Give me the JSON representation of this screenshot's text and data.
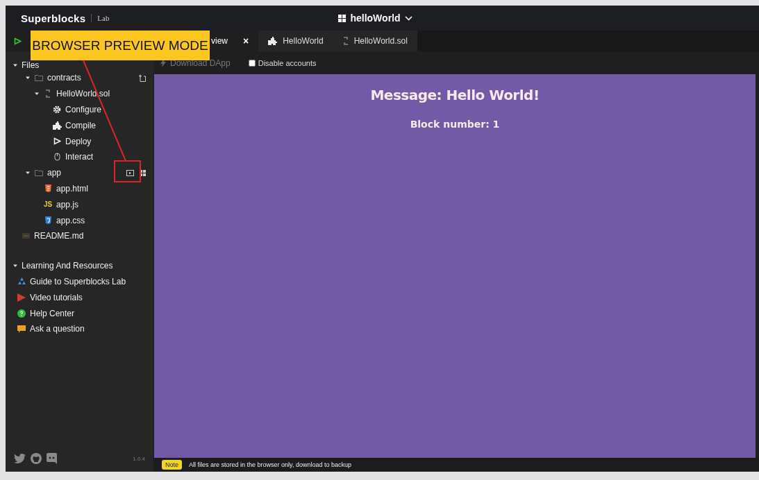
{
  "header": {
    "logo": "Superblocks",
    "product": "Lab",
    "project": "helloWorld"
  },
  "sidebar": {
    "files": {
      "label": "Files",
      "expanded": true,
      "children": [
        {
          "label": "contracts",
          "kind": "folder",
          "expanded": true,
          "new_file_button": true,
          "children": [
            {
              "label": "HelloWorld.sol",
              "kind": "contract",
              "expanded": true,
              "children": [
                {
                  "label": "Configure",
                  "kind": "gear"
                },
                {
                  "label": "Compile",
                  "kind": "puzzle"
                },
                {
                  "label": "Deploy",
                  "kind": "play"
                },
                {
                  "label": "Interact",
                  "kind": "mouse"
                }
              ]
            }
          ]
        },
        {
          "label": "app",
          "kind": "folder",
          "expanded": true,
          "preview_buttons": true,
          "children": [
            {
              "label": "app.html",
              "kind": "html"
            },
            {
              "label": "app.js",
              "kind": "js",
              "icon_text": "JS"
            },
            {
              "label": "app.css",
              "kind": "css"
            }
          ]
        },
        {
          "label": "README.md",
          "kind": "readme"
        }
      ]
    },
    "resources": {
      "label": "Learning And Resources",
      "expanded": true,
      "items": [
        {
          "label": "Guide to Superblocks Lab",
          "kind": "guide"
        },
        {
          "label": "Video tutorials",
          "kind": "video"
        },
        {
          "label": "Help Center",
          "kind": "help"
        },
        {
          "label": "Ask a question",
          "kind": "chat"
        }
      ]
    },
    "version": "1.0.4"
  },
  "tabs": [
    {
      "label": "view",
      "selected": true,
      "close": "×"
    },
    {
      "label": "HelloWorld",
      "selected": false,
      "kind": "puzzle"
    },
    {
      "label": "HelloWorld.sol",
      "selected": false,
      "kind": "contract"
    }
  ],
  "toolbar": {
    "download": {
      "label": "Download DApp",
      "disabled": true
    },
    "disable_accounts": {
      "label": "Disable accounts",
      "checked": false
    }
  },
  "preview": {
    "message": "Message: Hello World!",
    "block": "Block number: 1"
  },
  "status_bar": {
    "badge": "Note",
    "text": "All files are stored in the browser only, download to backup"
  },
  "callout": {
    "text": "BROWSER PREVIEW MODE"
  }
}
